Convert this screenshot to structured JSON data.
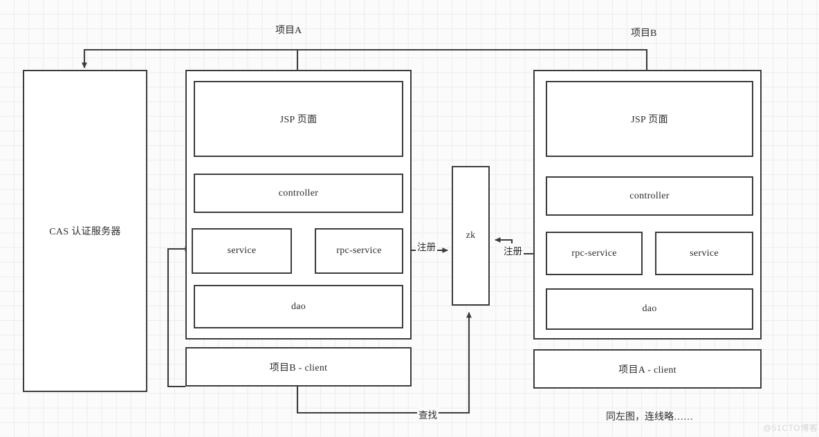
{
  "diagram": {
    "title_labels": {
      "project_a": "项目A",
      "project_b": "项目B"
    },
    "cas": {
      "label": "CAS 认证服务器"
    },
    "project_a_stack": {
      "jsp": "JSP 页面",
      "controller": "controller",
      "service": "service",
      "rpc_service": "rpc-service",
      "dao": "dao",
      "client": "项目B - client"
    },
    "project_b_stack": {
      "jsp": "JSP 页面",
      "controller": "controller",
      "rpc_service": "rpc-service",
      "service": "service",
      "dao": "dao",
      "client": "项目A - client"
    },
    "registry": {
      "label": "zk",
      "register_left": "注册",
      "register_right": "注册",
      "lookup": "查找"
    },
    "note": "同左图，连线略……",
    "watermark": "@51CTO博客",
    "colors": {
      "stroke": "#3b3b3b",
      "box_fill": "#ffffff",
      "text": "#2b2b2b",
      "grid": "#ececec",
      "page_bg": "#fbfbfb",
      "watermark": "#d6d6d6"
    }
  }
}
